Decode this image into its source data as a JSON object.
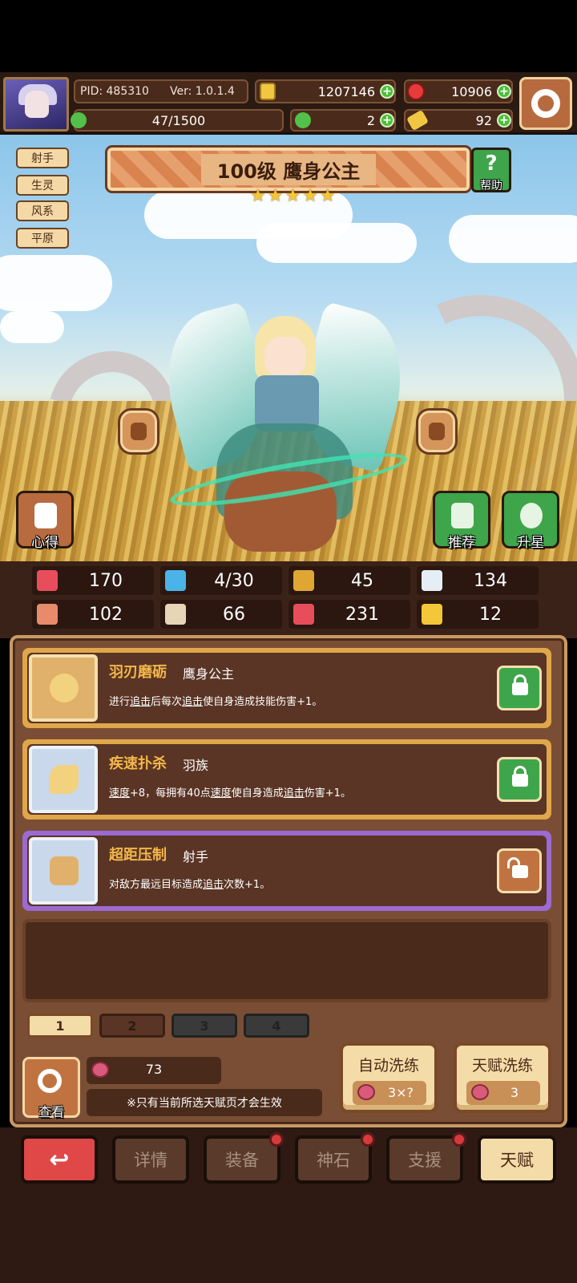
{
  "header": {
    "pid": "PID: 485310",
    "version": "Ver: 1.0.1.4",
    "gold": "1207146",
    "gems": "10906",
    "exp": "47/1500",
    "clovers": "2",
    "bones": "92"
  },
  "tags": [
    "射手",
    "生灵",
    "风系",
    "平原"
  ],
  "hero": {
    "title": "100级  鹰身公主",
    "star_count": 5,
    "help_label": "帮助",
    "notes_label": "心得",
    "recommend_label": "推荐",
    "upgrade_label": "升星"
  },
  "stats": [
    {
      "icon": "heart-icon",
      "value": "170"
    },
    {
      "icon": "drop-icon",
      "value": "4/30"
    },
    {
      "icon": "shield-icon",
      "value": "45"
    },
    {
      "icon": "wing-icon",
      "value": "134"
    },
    {
      "icon": "fist-icon",
      "value": "102"
    },
    {
      "icon": "book-icon",
      "value": "66"
    },
    {
      "icon": "crit-icon",
      "value": "231"
    },
    {
      "icon": "horseshoe-icon",
      "value": "12"
    }
  ],
  "talents": [
    {
      "name": "羽刃磨砺",
      "sub": "鹰身公主",
      "desc_parts": [
        "进行",
        "追击",
        "后每次",
        "追击",
        "使自身造成技能伤害+1。"
      ],
      "locked": true
    },
    {
      "name": "疾速扑杀",
      "sub": "羽族",
      "desc_parts": [
        "",
        "速度",
        "+8，每拥有40点",
        "速度",
        "使自身造成",
        "追击",
        "伤害+1。"
      ],
      "locked": true
    },
    {
      "name": "超距压制",
      "sub": "射手",
      "desc_parts": [
        "对敌方最远目标造成",
        "追击",
        "次数+1。"
      ],
      "locked": false
    }
  ],
  "pages": [
    "1",
    "2",
    "3",
    "4"
  ],
  "bottom": {
    "view_label": "查看",
    "fruit_count": "73",
    "note": "※只有当前所选天赋页才会生效",
    "auto_refine_label": "自动洗练",
    "auto_refine_cost": "3×?",
    "talent_refine_label": "天赋洗练",
    "talent_refine_cost": "3"
  },
  "nav": {
    "details": "详情",
    "equip": "装备",
    "stone": "神石",
    "support": "支援",
    "talent": "天赋"
  },
  "colors": {
    "green": "#3ea54b",
    "locked_border": "#e0a64a",
    "unlocked_border": "#9b6ad2",
    "back_red": "#e04747"
  }
}
